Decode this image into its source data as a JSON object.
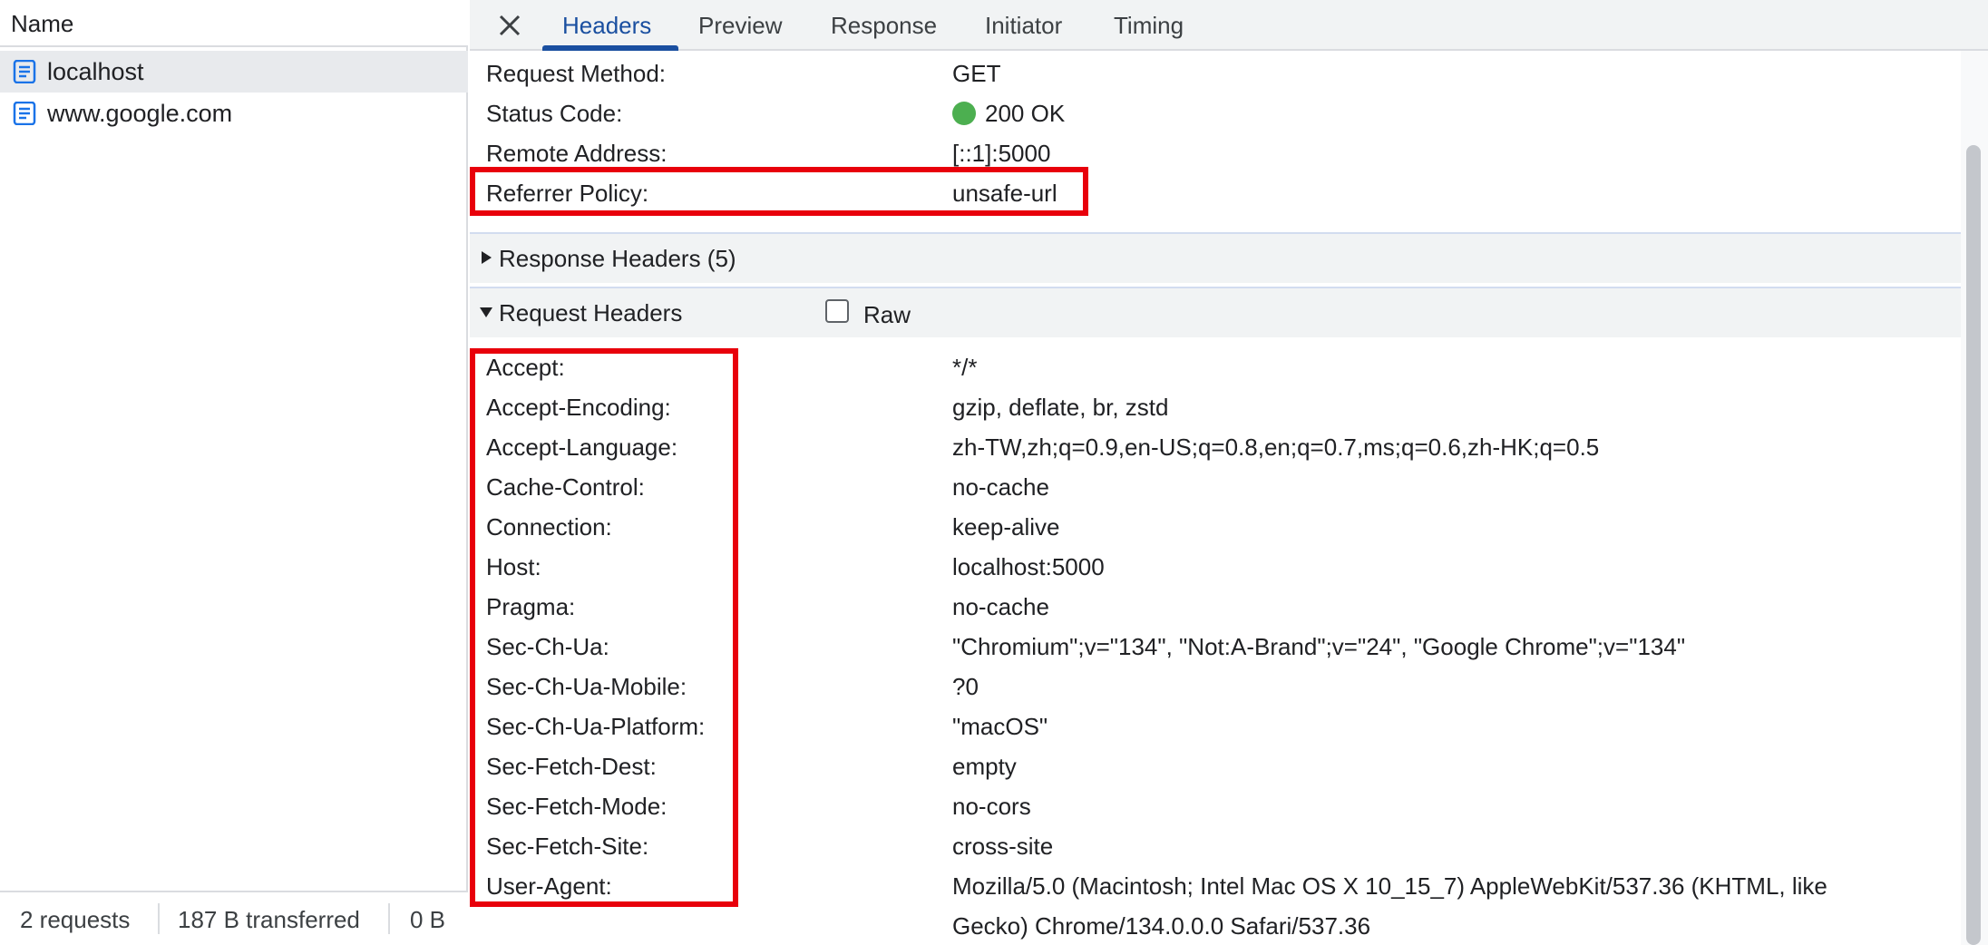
{
  "request_list": {
    "column_header": "Name",
    "items": [
      {
        "label": "localhost",
        "selected": true
      },
      {
        "label": "www.google.com",
        "selected": false
      }
    ],
    "status": {
      "requests": "2 requests",
      "transferred": "187 B transferred",
      "resources": "0 B"
    }
  },
  "tabs": {
    "items": [
      {
        "label": "Headers",
        "active": true
      },
      {
        "label": "Preview",
        "active": false
      },
      {
        "label": "Response",
        "active": false
      },
      {
        "label": "Initiator",
        "active": false
      },
      {
        "label": "Timing",
        "active": false
      }
    ]
  },
  "general": {
    "rows": [
      {
        "key": "Request Method:",
        "value": "GET"
      },
      {
        "key": "Status Code:",
        "value": "200 OK"
      },
      {
        "key": "Remote Address:",
        "value": "[::1]:5000"
      },
      {
        "key": "Referrer Policy:",
        "value": "unsafe-url"
      }
    ],
    "status_color": "#4caf50"
  },
  "response_headers": {
    "title": "Response Headers (5)",
    "expanded": false
  },
  "request_headers": {
    "title": "Request Headers",
    "expanded": true,
    "raw_label": "Raw",
    "raw_checked": false,
    "rows": [
      {
        "key": "Accept:",
        "value": "*/*"
      },
      {
        "key": "Accept-Encoding:",
        "value": "gzip, deflate, br, zstd"
      },
      {
        "key": "Accept-Language:",
        "value": "zh-TW,zh;q=0.9,en-US;q=0.8,en;q=0.7,ms;q=0.6,zh-HK;q=0.5"
      },
      {
        "key": "Cache-Control:",
        "value": "no-cache"
      },
      {
        "key": "Connection:",
        "value": "keep-alive"
      },
      {
        "key": "Host:",
        "value": "localhost:5000"
      },
      {
        "key": "Pragma:",
        "value": "no-cache"
      },
      {
        "key": "Sec-Ch-Ua:",
        "value": "\"Chromium\";v=\"134\", \"Not:A-Brand\";v=\"24\", \"Google Chrome\";v=\"134\""
      },
      {
        "key": "Sec-Ch-Ua-Mobile:",
        "value": "?0"
      },
      {
        "key": "Sec-Ch-Ua-Platform:",
        "value": "\"macOS\""
      },
      {
        "key": "Sec-Fetch-Dest:",
        "value": "empty"
      },
      {
        "key": "Sec-Fetch-Mode:",
        "value": "no-cors"
      },
      {
        "key": "Sec-Fetch-Site:",
        "value": "cross-site"
      },
      {
        "key": "User-Agent:",
        "value": "Mozilla/5.0 (Macintosh; Intel Mac OS X 10_15_7) AppleWebKit/537.36 (KHTML, like",
        "value_cont": "Gecko) Chrome/134.0.0.0 Safari/537.36"
      }
    ]
  },
  "colors": {
    "accent": "#1a4fa0",
    "highlight": "#e8000b",
    "doc_icon": "#1a73e8"
  },
  "icons": {
    "document": "document-icon",
    "close": "close-icon",
    "collapsed": "triangle-right-icon",
    "expanded": "triangle-down-icon"
  }
}
